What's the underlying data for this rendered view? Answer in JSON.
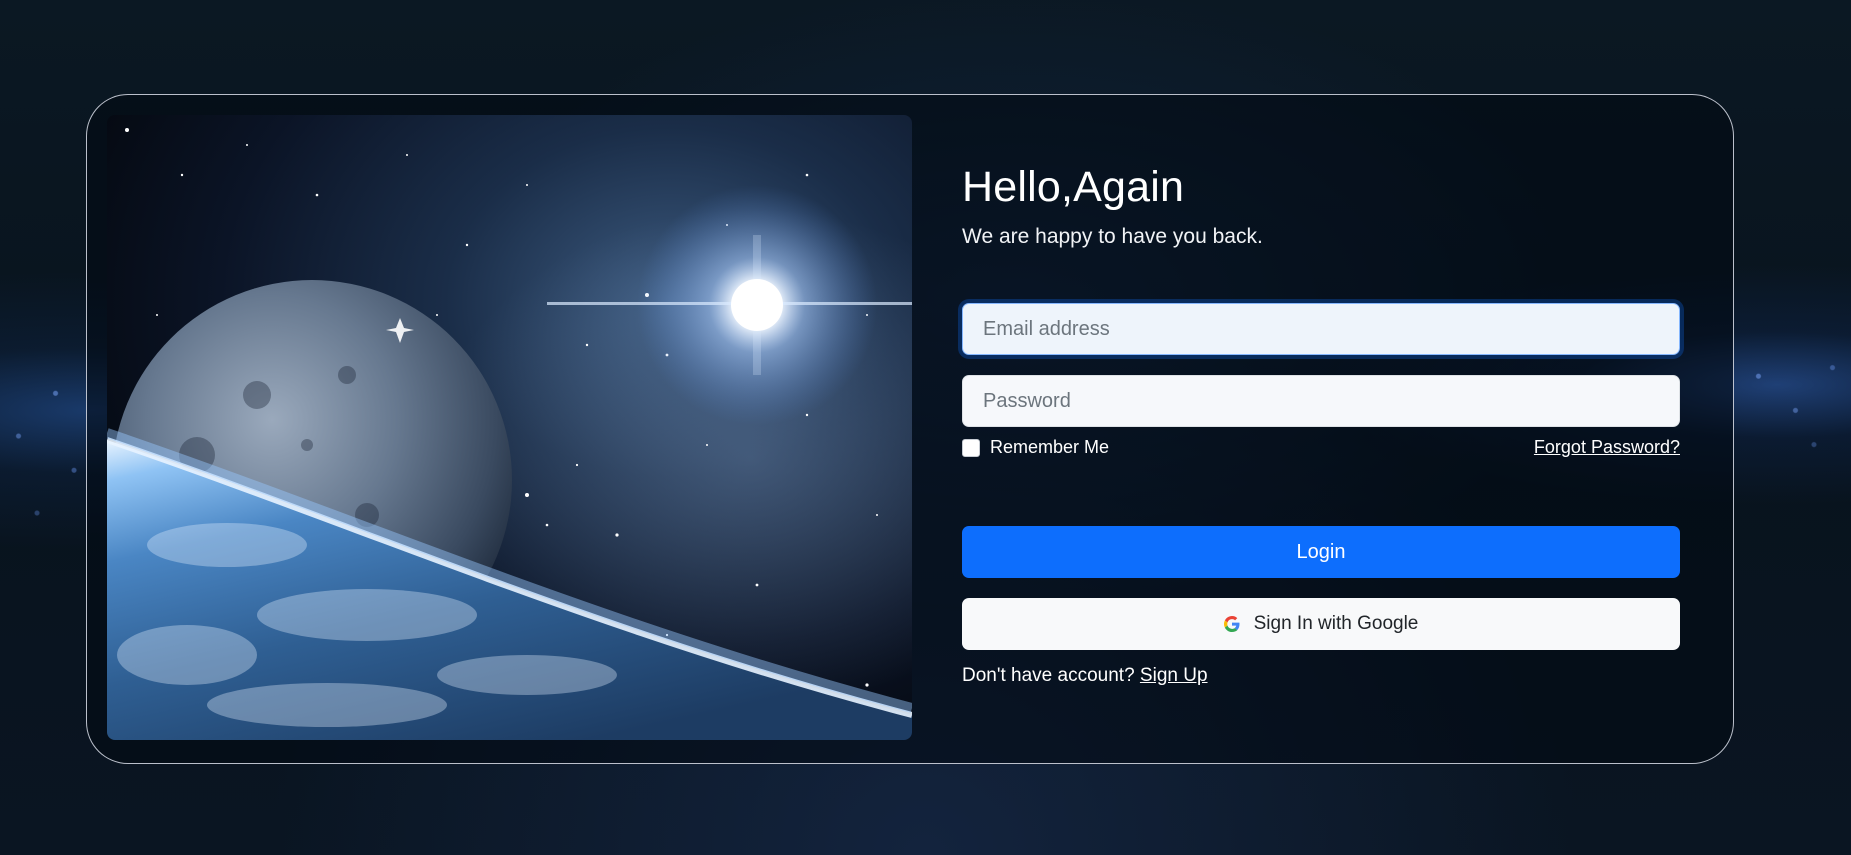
{
  "login": {
    "heading": "Hello,Again",
    "subheading": "We are happy to have you back.",
    "email_placeholder": "Email address",
    "password_placeholder": "Password",
    "remember_label": "Remember Me",
    "forgot_label": "Forgot Password?",
    "login_label": "Login",
    "google_label": "Sign In with Google",
    "signup_prompt": "Don't have account?",
    "signup_link": "Sign Up"
  },
  "icons": {
    "google": "google-icon"
  },
  "colors": {
    "primary": "#0d6efd",
    "background": "#08131d",
    "card_border": "#dce1eb"
  }
}
